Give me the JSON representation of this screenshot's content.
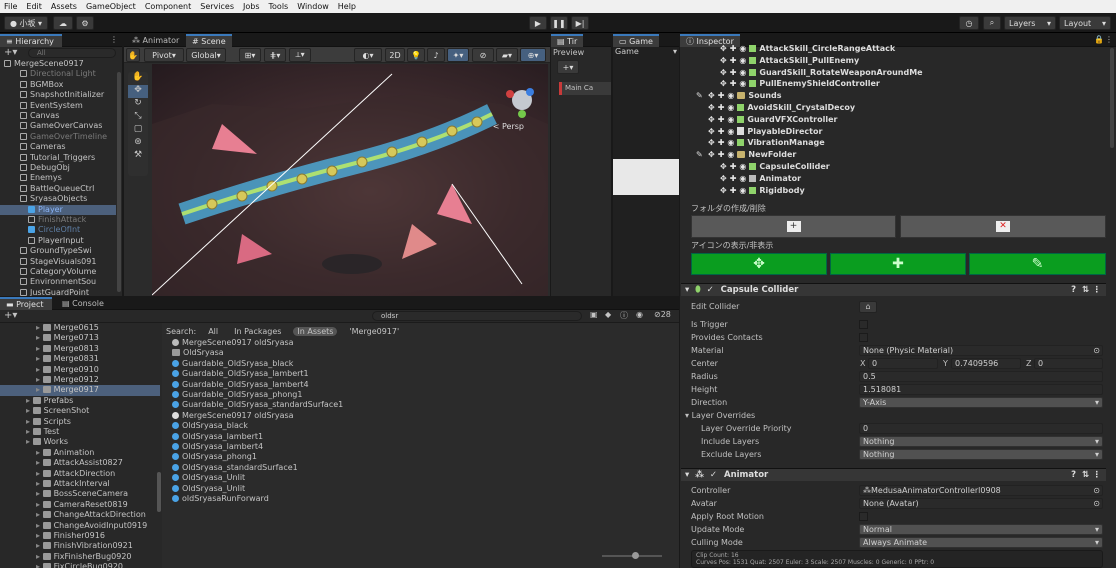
{
  "menu": [
    "File",
    "Edit",
    "Assets",
    "GameObject",
    "Component",
    "Services",
    "Jobs",
    "Tools",
    "Window",
    "Help"
  ],
  "toolbar": {
    "account": "小坂",
    "layers": "Layers",
    "layout": "Layout"
  },
  "tabs": {
    "hierarchy": "Hierarchy",
    "animator": "Animator",
    "scene": "Scene",
    "timeline": "Tir",
    "game": "Game",
    "inspector": "Inspector",
    "project": "Project",
    "console": "Console"
  },
  "hierarchy": {
    "search_placeholder": "All",
    "items": [
      {
        "label": "MergeScene0917",
        "indent": 0,
        "kind": "scene",
        "sel": false,
        "dim": false
      },
      {
        "label": "Directional Light",
        "indent": 2,
        "kind": "go",
        "sel": false,
        "dim": true
      },
      {
        "label": "BGMBox",
        "indent": 2,
        "kind": "go",
        "sel": false,
        "dim": false
      },
      {
        "label": "SnapshotInitializer",
        "indent": 2,
        "kind": "go",
        "sel": false,
        "dim": false
      },
      {
        "label": "EventSystem",
        "indent": 2,
        "kind": "go",
        "sel": false,
        "dim": false
      },
      {
        "label": "Canvas",
        "indent": 2,
        "kind": "go",
        "sel": false,
        "dim": false
      },
      {
        "label": "GameOverCanvas",
        "indent": 2,
        "kind": "go",
        "sel": false,
        "dim": false
      },
      {
        "label": "GameOverTimeline",
        "indent": 2,
        "kind": "go",
        "sel": false,
        "dim": true
      },
      {
        "label": "Cameras",
        "indent": 2,
        "kind": "go",
        "sel": false,
        "dim": false
      },
      {
        "label": "Tutorial_Triggers",
        "indent": 2,
        "kind": "go",
        "sel": false,
        "dim": false
      },
      {
        "label": "DebugObj",
        "indent": 2,
        "kind": "go",
        "sel": false,
        "dim": false
      },
      {
        "label": "Enemys",
        "indent": 2,
        "kind": "go",
        "sel": false,
        "dim": false
      },
      {
        "label": "BattleQueueCtrl",
        "indent": 2,
        "kind": "go",
        "sel": false,
        "dim": false
      },
      {
        "label": "SryasaObjects",
        "indent": 2,
        "kind": "go",
        "sel": false,
        "dim": false
      },
      {
        "label": "Player",
        "indent": 3,
        "kind": "prefab",
        "sel": true,
        "dim": false
      },
      {
        "label": "FinishAttack",
        "indent": 3,
        "kind": "go",
        "sel": false,
        "dim": true
      },
      {
        "label": "CircleOfInt",
        "indent": 3,
        "kind": "prefab",
        "sel": false,
        "dim": true
      },
      {
        "label": "PlayerInput",
        "indent": 3,
        "kind": "go",
        "sel": false,
        "dim": false
      },
      {
        "label": "GroundTypeSwi",
        "indent": 2,
        "kind": "go",
        "sel": false,
        "dim": false
      },
      {
        "label": "StageVisuals091",
        "indent": 2,
        "kind": "go",
        "sel": false,
        "dim": false
      },
      {
        "label": "CategoryVolume",
        "indent": 2,
        "kind": "go",
        "sel": false,
        "dim": false
      },
      {
        "label": "EnvironmentSou",
        "indent": 2,
        "kind": "go",
        "sel": false,
        "dim": false
      },
      {
        "label": "JustGuardPoint",
        "indent": 2,
        "kind": "go",
        "sel": false,
        "dim": false
      }
    ]
  },
  "scene_toolbar": {
    "pivot": "Pivot",
    "global": "Global",
    "mode": "2D",
    "persp": "< Persp"
  },
  "game_panel": {
    "preview": "Preview",
    "display": "Game",
    "camera": "Main Ca"
  },
  "project": {
    "search_value": "oldsr",
    "search_label": "Search:",
    "filters": [
      "All",
      "In Packages",
      "In Assets",
      "'Merge0917'"
    ],
    "count": "28",
    "tree": [
      {
        "label": "Merge0615",
        "indent": 3,
        "sel": false
      },
      {
        "label": "Merge0713",
        "indent": 3,
        "sel": false
      },
      {
        "label": "Merge0813",
        "indent": 3,
        "sel": false
      },
      {
        "label": "Merge0831",
        "indent": 3,
        "sel": false
      },
      {
        "label": "Merge0910",
        "indent": 3,
        "sel": false
      },
      {
        "label": "Merge0912",
        "indent": 3,
        "sel": false
      },
      {
        "label": "Merge0917",
        "indent": 3,
        "sel": true
      },
      {
        "label": "Prefabs",
        "indent": 2,
        "sel": false
      },
      {
        "label": "ScreenShot",
        "indent": 2,
        "sel": false
      },
      {
        "label": "Scripts",
        "indent": 2,
        "sel": false
      },
      {
        "label": "Test",
        "indent": 2,
        "sel": false
      },
      {
        "label": "Works",
        "indent": 2,
        "sel": false
      },
      {
        "label": "Animation",
        "indent": 3,
        "sel": false
      },
      {
        "label": "AttackAssist0827",
        "indent": 3,
        "sel": false
      },
      {
        "label": "AttackDirection",
        "indent": 3,
        "sel": false
      },
      {
        "label": "AttackInterval",
        "indent": 3,
        "sel": false
      },
      {
        "label": "BossSceneCamera",
        "indent": 3,
        "sel": false
      },
      {
        "label": "CameraReset0819",
        "indent": 3,
        "sel": false
      },
      {
        "label": "ChangeAttackDirection",
        "indent": 3,
        "sel": false
      },
      {
        "label": "ChangeAvoidInput0919",
        "indent": 3,
        "sel": false
      },
      {
        "label": "Finisher0916",
        "indent": 3,
        "sel": false
      },
      {
        "label": "FinishVibration0921",
        "indent": 3,
        "sel": false
      },
      {
        "label": "FixFinisherBug0920",
        "indent": 3,
        "sel": false
      },
      {
        "label": "FixCircleBug0920",
        "indent": 3,
        "sel": false
      }
    ],
    "results": [
      {
        "label": "MergeScene0917 oldSryasa",
        "icon": "scene-icon"
      },
      {
        "label": "OldSryasa",
        "icon": "folder-icon"
      },
      {
        "label": "Guardable_OldSryasa_black",
        "icon": "material-icon"
      },
      {
        "label": "Guardable_OldSryasa_lambert1",
        "icon": "material-icon"
      },
      {
        "label": "Guardable_OldSryasa_lambert4",
        "icon": "material-icon"
      },
      {
        "label": "Guardable_OldSryasa_phong1",
        "icon": "material-icon"
      },
      {
        "label": "Guardable_OldSryasa_standardSurface1",
        "icon": "material-icon"
      },
      {
        "label": "MergeScene0917 oldSryasa",
        "icon": "unity-icon"
      },
      {
        "label": "OldSryasa_black",
        "icon": "material-icon"
      },
      {
        "label": "OldSryasa_lambert1",
        "icon": "material-icon"
      },
      {
        "label": "OldSryasa_lambert4",
        "icon": "material-icon"
      },
      {
        "label": "OldSryasa_phong1",
        "icon": "material-icon"
      },
      {
        "label": "OldSryasa_standardSurface1",
        "icon": "material-icon"
      },
      {
        "label": "OldSryasa_Unlit",
        "icon": "material-icon"
      },
      {
        "label": "OldSryasa_Unlit",
        "icon": "material-icon"
      },
      {
        "label": "oldSryasaRunForward",
        "icon": "anim-icon"
      }
    ]
  },
  "inspector": {
    "tree": [
      {
        "label": "AttackSkill_CircleRangeAttack",
        "indent": 1,
        "kind": "script",
        "pen": false
      },
      {
        "label": "AttackSkill_PullEnemy",
        "indent": 1,
        "kind": "script",
        "pen": false
      },
      {
        "label": "GuardSkill_RotateWeaponAroundMe",
        "indent": 1,
        "kind": "script",
        "pen": false
      },
      {
        "label": "PullEnemyShieldController",
        "indent": 1,
        "kind": "script",
        "pen": false
      },
      {
        "label": "Sounds",
        "indent": 0,
        "kind": "folder",
        "pen": true
      },
      {
        "label": "AvoidSkill_CrystalDecoy",
        "indent": 0,
        "kind": "script",
        "pen": false
      },
      {
        "label": "GuardVFXController",
        "indent": 0,
        "kind": "script",
        "pen": false
      },
      {
        "label": "PlayableDirector",
        "indent": 0,
        "kind": "doc",
        "pen": false
      },
      {
        "label": "VibrationManage",
        "indent": 0,
        "kind": "script",
        "pen": false
      },
      {
        "label": "NewFolder",
        "indent": 0,
        "kind": "folder",
        "pen": true
      },
      {
        "label": "CapsuleCollider",
        "indent": 1,
        "kind": "script",
        "pen": false
      },
      {
        "label": "Animator",
        "indent": 1,
        "kind": "anim",
        "pen": false
      },
      {
        "label": "Rigidbody",
        "indent": 1,
        "kind": "rb",
        "pen": false
      }
    ],
    "folder_label": "フォルダの作成/削除",
    "icon_label": "アイコンの表示/非表示",
    "capsule": {
      "title": "Capsule Collider",
      "edit_collider": "Edit Collider",
      "is_trigger": "Is Trigger",
      "provides_contacts": "Provides Contacts",
      "material": "Material",
      "material_value": "None (Physic Material)",
      "center": "Center",
      "cx": "0",
      "cy": "0.7409596",
      "cz": "0",
      "radius": "Radius",
      "radius_value": "0.5",
      "height": "Height",
      "height_value": "1.518081",
      "direction": "Direction",
      "direction_value": "Y-Axis",
      "layer_overrides": "Layer Overrides",
      "priority": "Layer Override Priority",
      "priority_value": "0",
      "include": "Include Layers",
      "include_value": "Nothing",
      "exclude": "Exclude Layers",
      "exclude_value": "Nothing"
    },
    "animator": {
      "title": "Animator",
      "controller": "Controller",
      "controller_value": "MedusaAnimatorControllerl0908",
      "avatar": "Avatar",
      "avatar_value": "None (Avatar)",
      "apply_root_motion": "Apply Root Motion",
      "update_mode": "Update Mode",
      "update_mode_value": "Normal",
      "culling_mode": "Culling Mode",
      "culling_mode_value": "Always Animate",
      "info1": "Clip Count: 16",
      "info2": "Curves Pos: 1531 Quat: 2507 Euler: 3 Scale: 2507 Muscles: 0 Generic: 0 PPtr: 0"
    }
  }
}
